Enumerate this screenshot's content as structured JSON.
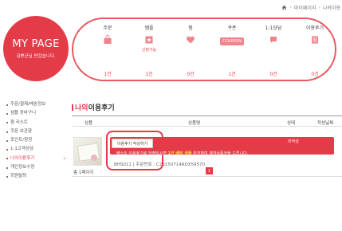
{
  "breadcrumb": {
    "items": [
      "마이페이지",
      "나의이용"
    ]
  },
  "mypage": {
    "title": "MY PAGE",
    "greeting": "김뽀군님 반갑습니다."
  },
  "summary": [
    {
      "label": "주문",
      "icon": "bag-icon",
      "sub": "",
      "count": "1건"
    },
    {
      "label": "쌤플",
      "icon": "star-icon",
      "sub": "신청가능",
      "count": "1건"
    },
    {
      "label": "찜",
      "icon": "heart-icon",
      "sub": "",
      "count": "0건"
    },
    {
      "label": "쿠폰",
      "icon": "coupon-icon",
      "sub": "",
      "badge": "COUPON",
      "count": "1건"
    },
    {
      "label": "1:1상담",
      "icon": "chat-icon",
      "sub": "",
      "count": "0건"
    },
    {
      "label": "이용후기",
      "icon": "review-icon",
      "sub": "",
      "count": "0건"
    }
  ],
  "sidebar": {
    "items": [
      {
        "label": "주문/결제/배송정보",
        "active": false
      },
      {
        "label": "샘플 장바구니",
        "active": false
      },
      {
        "label": "찜 리스트",
        "active": false
      },
      {
        "label": "쿠폰 보관함",
        "active": false
      },
      {
        "label": "포인트/청정",
        "active": false
      },
      {
        "label": "1:1고객상담",
        "active": false
      },
      {
        "label": "나의이용후기",
        "active": true
      },
      {
        "label": "개인정보수정",
        "active": false
      },
      {
        "label": "회원탈퇴",
        "active": false
      }
    ]
  },
  "section": {
    "title_accent": "나의",
    "title_rest": "이용후기"
  },
  "table": {
    "headers": {
      "product": "상품",
      "product_name": "상품명",
      "status": "상태",
      "date": "작성날짜"
    }
  },
  "row": {
    "write_button": "이용후기 작성하기",
    "tooltip_prefix": "베스트 이용후기로 당첨되시면 ",
    "tooltip_highlight": "1건 배달 샘플",
    "tooltip_suffix": " 추천하여 계약상품권을 드립니다.",
    "status": "미작성",
    "product_code": "BHS011",
    "order_label": "주문번호",
    "order_number": "C20150714RDX59570"
  },
  "footer": {
    "total": "총 1페이지",
    "page": "1"
  },
  "colors": {
    "accent": "#e33b48",
    "panel_border": "#e8585f",
    "tooltip_highlight": "#ffe14d"
  }
}
